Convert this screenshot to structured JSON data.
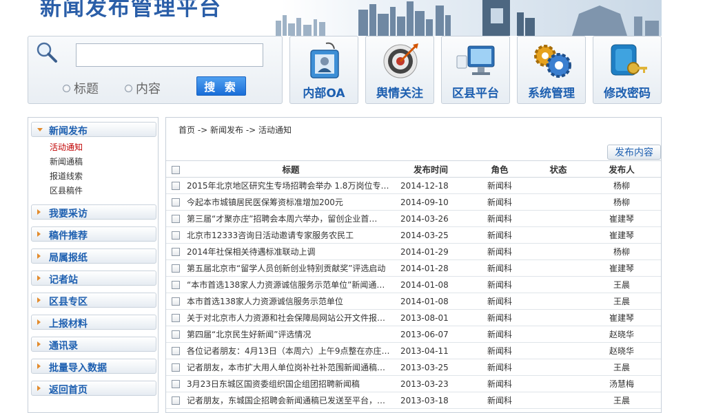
{
  "header": {
    "title": "新闻发布管理平台"
  },
  "search": {
    "placeholder": "",
    "value": "",
    "radio_title": "标题",
    "radio_content": "内容",
    "button_label": "搜 索"
  },
  "nav": [
    {
      "label": "内部OA",
      "icon": "id-badge-icon"
    },
    {
      "label": "舆情关注",
      "icon": "target-icon"
    },
    {
      "label": "区县平台",
      "icon": "monitor-icon"
    },
    {
      "label": "系统管理",
      "icon": "gears-icon"
    },
    {
      "label": "修改密码",
      "icon": "key-icon"
    }
  ],
  "sidebar": {
    "groups": [
      {
        "label": "新闻发布",
        "expanded": true
      },
      {
        "label": "我要采访"
      },
      {
        "label": "稿件推荐"
      },
      {
        "label": "局属报纸"
      },
      {
        "label": "记者站"
      },
      {
        "label": "区县专区"
      },
      {
        "label": "上报材料"
      },
      {
        "label": "通讯录"
      },
      {
        "label": "批量导入数据"
      },
      {
        "label": "返回首页"
      }
    ],
    "sub_items": [
      "活动通知",
      "新闻通稿",
      "报道线索",
      "区县稿件"
    ],
    "active_sub": "活动通知"
  },
  "breadcrumb": "首页 -> 新闻发布 -> 活动通知",
  "publish_button": "发布内容",
  "table": {
    "headers": [
      "标题",
      "发布时间",
      "角色",
      "状态",
      "发布人"
    ],
    "rows": [
      {
        "title": "2015年北京地区研究生专场招聘会举办 1.8万岗位专…",
        "date": "2014-12-18",
        "role": "新闻科",
        "status": "",
        "publisher": "杨柳"
      },
      {
        "title": "今起本市城镇居民医保筹资标准增加200元",
        "date": "2014-09-10",
        "role": "新闻科",
        "status": "",
        "publisher": "杨柳"
      },
      {
        "title": "第三届“才聚亦庄”招聘会本周六举办，留创企业首…",
        "date": "2014-03-26",
        "role": "新闻科",
        "status": "",
        "publisher": "崔建琴"
      },
      {
        "title": "北京市12333咨询日活动邀请专家服务农民工",
        "date": "2014-03-25",
        "role": "新闻科",
        "status": "",
        "publisher": "崔建琴"
      },
      {
        "title": "2014年社保相关待遇标准联动上调",
        "date": "2014-01-29",
        "role": "新闻科",
        "status": "",
        "publisher": "杨柳"
      },
      {
        "title": "第五届北京市“留学人员创新创业特别贡献奖”评选启动",
        "date": "2014-01-28",
        "role": "新闻科",
        "status": "",
        "publisher": "崔建琴"
      },
      {
        "title": "“本市首选138家人力资源诚信服务示范单位”新闻通…",
        "date": "2014-01-08",
        "role": "新闻科",
        "status": "",
        "publisher": "王晨"
      },
      {
        "title": "本市首选138家人力资源诚信服务示范单位",
        "date": "2014-01-08",
        "role": "新闻科",
        "status": "",
        "publisher": "王晨"
      },
      {
        "title": "关于对北京市人力资源和社会保障局网站公开文件报…",
        "date": "2013-08-01",
        "role": "新闻科",
        "status": "",
        "publisher": "崔建琴"
      },
      {
        "title": "第四届“北京民生好新闻”评选情况",
        "date": "2013-06-07",
        "role": "新闻科",
        "status": "",
        "publisher": "赵晓华"
      },
      {
        "title": "各位记者朋友：4月13日（本周六）上午9点整在亦庄…",
        "date": "2013-04-11",
        "role": "新闻科",
        "status": "",
        "publisher": "赵晓华"
      },
      {
        "title": "记者朋友，本市扩大用人单位岗补社补范围新闻通稿…",
        "date": "2013-03-25",
        "role": "新闻科",
        "status": "",
        "publisher": "王晨"
      },
      {
        "title": "3月23日东城区国资委组织国企组团招聘新闻稿",
        "date": "2013-03-23",
        "role": "新闻科",
        "status": "",
        "publisher": "汤慧梅"
      },
      {
        "title": "记者朋友，东城国企招聘会新闻通稿已发送至平台，…",
        "date": "2013-03-18",
        "role": "新闻科",
        "status": "",
        "publisher": "王晨"
      }
    ]
  }
}
